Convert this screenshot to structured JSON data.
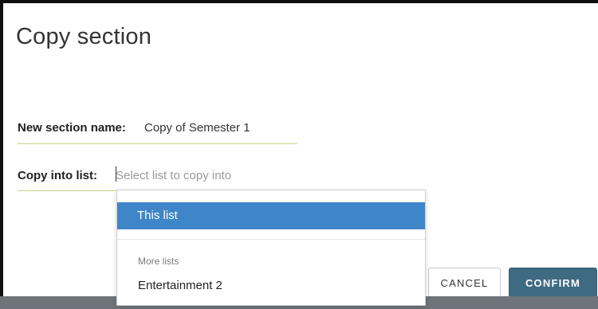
{
  "dialog": {
    "title": "Copy section",
    "section_name": {
      "label": "New section name:",
      "value": "Copy of Semester 1"
    },
    "copy_into_list": {
      "label": "Copy into list:",
      "placeholder": "Select list to copy into"
    },
    "dropdown": {
      "selected_option": "This list",
      "group_header": "More lists",
      "options": [
        "Entertainment 2"
      ]
    },
    "buttons": {
      "cancel": "CANCEL",
      "confirm": "CONFIRM"
    }
  },
  "colors": {
    "accent_selected": "#3f86c8",
    "confirm_button": "#3e6b82",
    "underline": "#c9d48c",
    "footer_bar": "#6d757a"
  }
}
